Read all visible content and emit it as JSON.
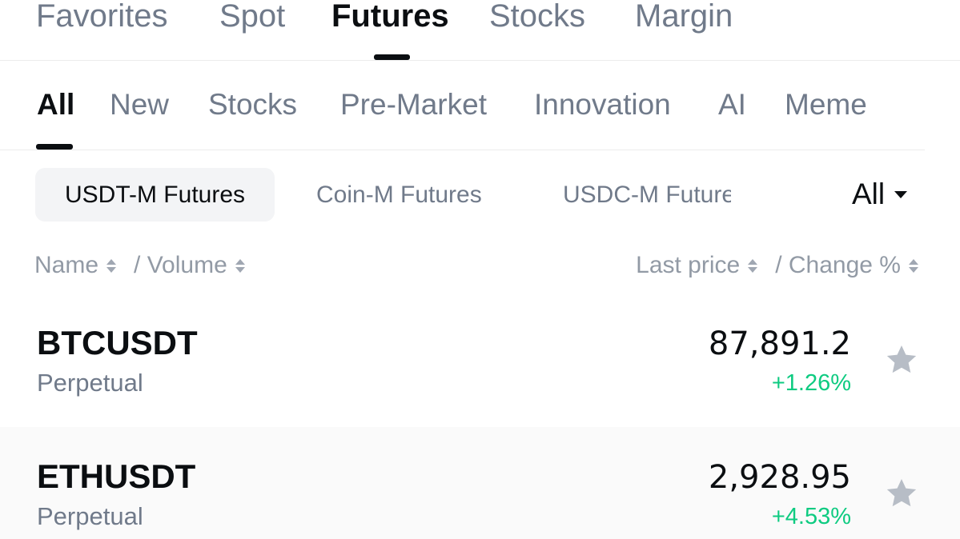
{
  "top_tabs": [
    {
      "label": "Favorites"
    },
    {
      "label": "Spot"
    },
    {
      "label": "Futures"
    },
    {
      "label": "Stocks"
    },
    {
      "label": "Margin"
    }
  ],
  "category_tabs": [
    {
      "label": "All"
    },
    {
      "label": "New"
    },
    {
      "label": "Stocks"
    },
    {
      "label": "Pre-Market"
    },
    {
      "label": "Innovation"
    },
    {
      "label": "AI"
    },
    {
      "label": "Meme"
    }
  ],
  "contract_chips": [
    {
      "label": "USDT-M Futures"
    },
    {
      "label": "Coin-M Futures"
    },
    {
      "label": "USDC-M Futures"
    }
  ],
  "filter": {
    "label": "All"
  },
  "columns": {
    "name": "Name",
    "volume": "/ Volume",
    "last_price": "Last price",
    "change": "/ Change %"
  },
  "rows": [
    {
      "symbol": "BTCUSDT",
      "type": "Perpetual",
      "price": "87,891.2",
      "change": "+1.26%"
    },
    {
      "symbol": "ETHUSDT",
      "type": "Perpetual",
      "price": "2,928.95",
      "change": "+4.53%"
    }
  ],
  "colors": {
    "positive": "#0ecb81",
    "text_primary": "#0b0e11",
    "text_secondary": "#707a8a"
  },
  "icons": {
    "sort": "sort-icon",
    "dropdown": "caret-down-icon",
    "favorite": "star-icon"
  }
}
